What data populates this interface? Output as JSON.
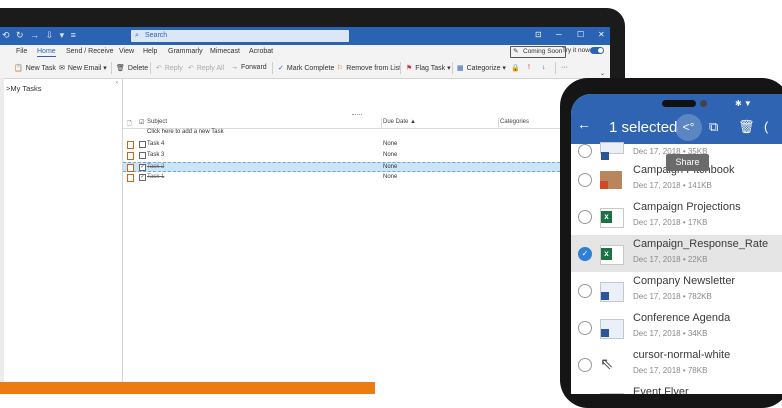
{
  "outlook": {
    "quick_access": "⟲ ↻ → ⇩ ▾ ≡",
    "search_placeholder": "Search",
    "window_controls": [
      "⊡",
      "─",
      "☐",
      "✕"
    ],
    "menu": [
      "File",
      "Home",
      "Send / Receive",
      "View",
      "Help",
      "Grammarly",
      "Mimecast",
      "Acrobat"
    ],
    "active_menu": "Home",
    "coming_soon": "Coming Soon",
    "try_it_now": "Try it now",
    "ribbon": {
      "new_task": "New Task",
      "new_email": "New Email",
      "delete": "Delete",
      "reply": "Reply",
      "reply_all": "Reply All",
      "forward": "Forward",
      "mark_complete": "Mark Complete",
      "remove_from_list": "Remove from List",
      "flag_task": "Flag Task",
      "categorize": "Categorize",
      "more": "···"
    },
    "folder": "My Tasks",
    "columns": {
      "subject": "Subject",
      "due_date": "Due Date ▲",
      "categories": "Categories"
    },
    "new_task_prompt": "Click here to add a new Task",
    "tasks": [
      {
        "subject": "Task 4",
        "due": "None",
        "completed": false,
        "selected": false
      },
      {
        "subject": "Task 3",
        "due": "None",
        "completed": false,
        "selected": false
      },
      {
        "subject": "Task 2",
        "due": "None",
        "completed": true,
        "selected": true
      },
      {
        "subject": "Task 1",
        "due": "None",
        "completed": true,
        "selected": false
      }
    ]
  },
  "phone": {
    "back_icon": "←",
    "selection_title": "1 selected",
    "share_icon": "share-icon",
    "tooltip": "Share",
    "files": [
      {
        "name": "",
        "meta": "Dec 17, 2018 • 35KB",
        "type": "doc",
        "checked": false
      },
      {
        "name": "Campaign Pitchbook",
        "meta": "Dec 17, 2018 • 141KB",
        "type": "ppt",
        "checked": false
      },
      {
        "name": "Campaign Projections",
        "meta": "Dec 17, 2018 • 17KB",
        "type": "xlsx",
        "checked": false
      },
      {
        "name": "Campaign_Response_Rate",
        "meta": "Dec 17, 2018 • 22KB",
        "type": "xlsx",
        "checked": true
      },
      {
        "name": "Company Newsletter",
        "meta": "Dec 17, 2018 • 782KB",
        "type": "doc",
        "checked": false
      },
      {
        "name": "Conference Agenda",
        "meta": "Dec 17, 2018 • 34KB",
        "type": "doc",
        "checked": false
      },
      {
        "name": "cursor-normal-white",
        "meta": "Dec 17, 2018 • 78KB",
        "type": "image",
        "checked": false
      },
      {
        "name": "Event Flyer",
        "meta": "",
        "type": "doc",
        "checked": false
      }
    ]
  },
  "colors": {
    "outlook_blue": "#2b63b4",
    "phone_header": "#2f64b2",
    "accent_orange": "#ec7b14",
    "excel_green": "#1e7145"
  }
}
